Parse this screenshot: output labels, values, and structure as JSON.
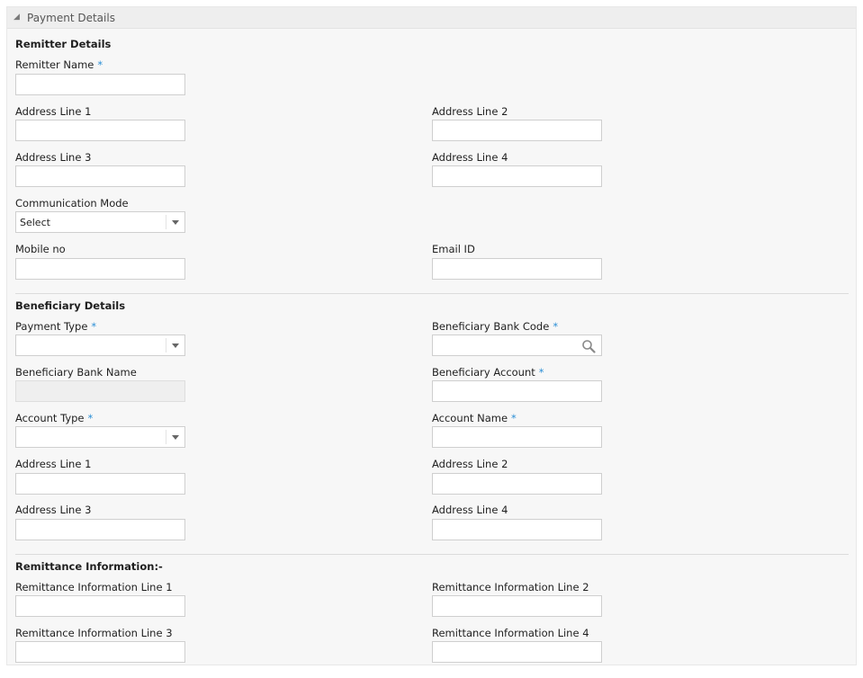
{
  "panel": {
    "title": "Payment Details"
  },
  "remitter": {
    "section_title": "Remitter Details",
    "name_label": "Remitter Name",
    "addr1_label": "Address Line 1",
    "addr2_label": "Address Line 2",
    "addr3_label": "Address Line 3",
    "addr4_label": "Address Line 4",
    "comm_mode_label": "Communication Mode",
    "comm_mode_value": "Select",
    "mobile_label": "Mobile no",
    "email_label": "Email ID"
  },
  "beneficiary": {
    "section_title": "Beneficiary Details",
    "payment_type_label": "Payment Type",
    "bank_code_label": "Beneficiary Bank Code",
    "bank_name_label": "Beneficiary Bank Name",
    "account_label": "Beneficiary Account",
    "account_type_label": "Account Type",
    "account_name_label": "Account Name",
    "addr1_label": "Address Line 1",
    "addr2_label": "Address Line 2",
    "addr3_label": "Address Line 3",
    "addr4_label": "Address Line 4"
  },
  "remittance": {
    "section_title": "Remittance Information:-",
    "line1_label": "Remittance Information Line 1",
    "line2_label": "Remittance Information Line 2",
    "line3_label": "Remittance Information Line 3",
    "line4_label": "Remittance Information Line 4"
  },
  "required_marker": "*",
  "icons": {
    "collapse": "triangle-collapse-icon",
    "search": "search-icon",
    "dropdown": "chevron-down-icon"
  },
  "colors": {
    "required": "#2c8fd6",
    "panel_bg": "#f7f7f7",
    "header_bg": "#eeeeee"
  }
}
